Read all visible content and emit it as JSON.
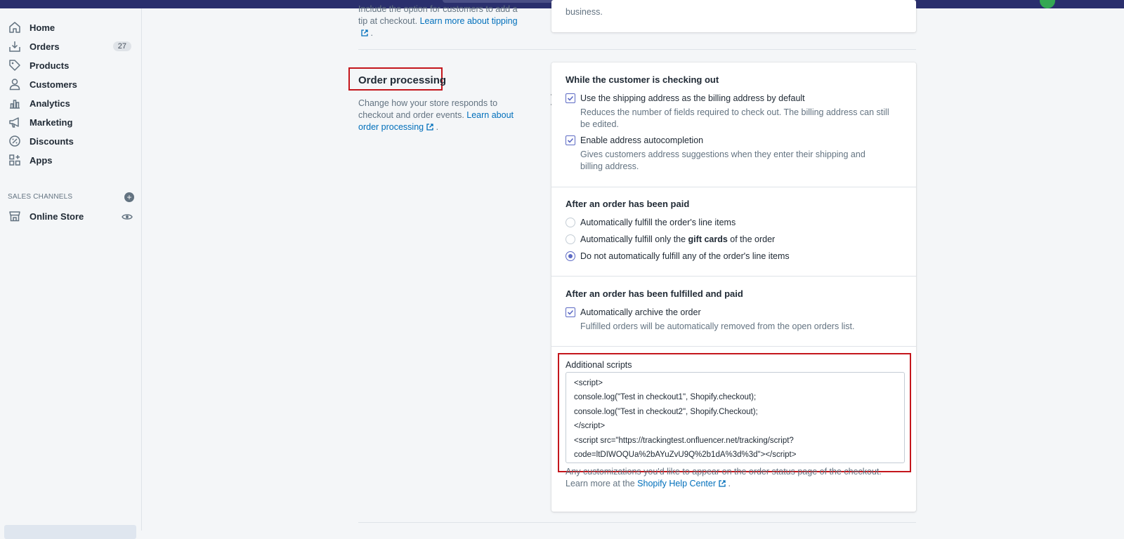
{
  "sidebar": {
    "items": [
      {
        "label": "Home",
        "icon": "home-icon"
      },
      {
        "label": "Orders",
        "icon": "orders-icon",
        "badge": "27"
      },
      {
        "label": "Products",
        "icon": "tag-icon"
      },
      {
        "label": "Customers",
        "icon": "person-icon"
      },
      {
        "label": "Analytics",
        "icon": "bar-chart-icon"
      },
      {
        "label": "Marketing",
        "icon": "megaphone-icon"
      },
      {
        "label": "Discounts",
        "icon": "discount-icon"
      },
      {
        "label": "Apps",
        "icon": "apps-grid-icon"
      }
    ],
    "channels_title": "SALES CHANNELS",
    "channels": [
      {
        "label": "Online Store",
        "icon": "store-icon"
      }
    ]
  },
  "tipping": {
    "description": "Include the option for customers to add a tip at checkout.",
    "link": "Learn more about tipping",
    "card_text": "business."
  },
  "order_processing": {
    "title": "Order processing",
    "description": "Change how your store responds to checkout and order events.",
    "link": "Learn about order processing",
    "checkout": {
      "heading": "While the customer is checking out",
      "opt1_label": "Use the shipping address as the billing address by default",
      "opt1_checked": true,
      "opt1_help": "Reduces the number of fields required to check out. The billing address can still be edited.",
      "opt2_label": "Enable address autocompletion",
      "opt2_checked": true,
      "opt2_help": "Gives customers address suggestions when they enter their shipping and billing address."
    },
    "paid": {
      "heading": "After an order has been paid",
      "radio1": "Automatically fulfill the order's line items",
      "radio2_pre": "Automatically fulfill only the ",
      "radio2_bold": "gift cards",
      "radio2_post": " of the order",
      "radio3": "Do not automatically fulfill any of the order's line items",
      "selected": 3
    },
    "fulfilled": {
      "heading": "After an order has been fulfilled and paid",
      "opt_label": "Automatically archive the order",
      "opt_checked": true,
      "opt_help": "Fulfilled orders will be automatically removed from the open orders list."
    },
    "scripts": {
      "label": "Additional scripts",
      "lines": [
        "<script>",
        "console.log(\"Test in checkout1\", Shopify.checkout);",
        "console.log(\"Test in checkout2\", Shopify.Checkout);",
        "</script>",
        "<script src=\"https://trackingtest.onfluencer.net/tracking/script?",
        "code=ltDIWOQUa%2bAYuZvU9Q%2b1dA%3d%3d\"></script>"
      ],
      "help": "Any customizations you'd like to appear on the order status page of the checkout. Learn more at the",
      "help_link": "Shopify Help Center"
    }
  },
  "colors": {
    "accent": "#5c6ac4",
    "link": "#006fbb",
    "highlight": "#c4161c",
    "topbar": "#2a2f6d"
  }
}
